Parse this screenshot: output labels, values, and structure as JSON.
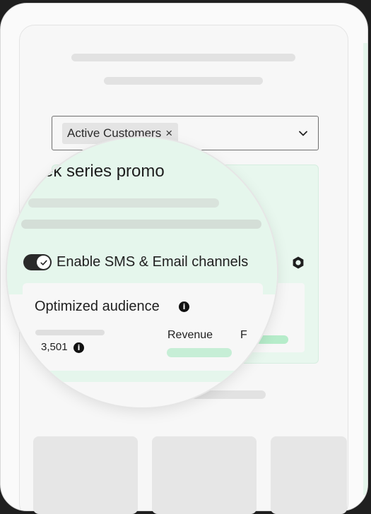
{
  "audience_select": {
    "chip_label": "Active Customers",
    "chip_remove": "×",
    "chevron_icon": "chevron-down-icon"
  },
  "campaign_card": {
    "title": "ek series promo",
    "settings_icon": "gear-icon"
  },
  "channels": {
    "toggle_label": "Enable SMS & Email channels",
    "toggle_on": true
  },
  "audience": {
    "title": "Optimized audience",
    "info_icon": "info-icon",
    "count": "3,501",
    "revenue_label": "Revenue",
    "second_label": "F"
  },
  "colors": {
    "accent_green": "#e5f6ec",
    "bar_green": "#c6eed6",
    "toggle_dark": "#2a2a2a"
  }
}
